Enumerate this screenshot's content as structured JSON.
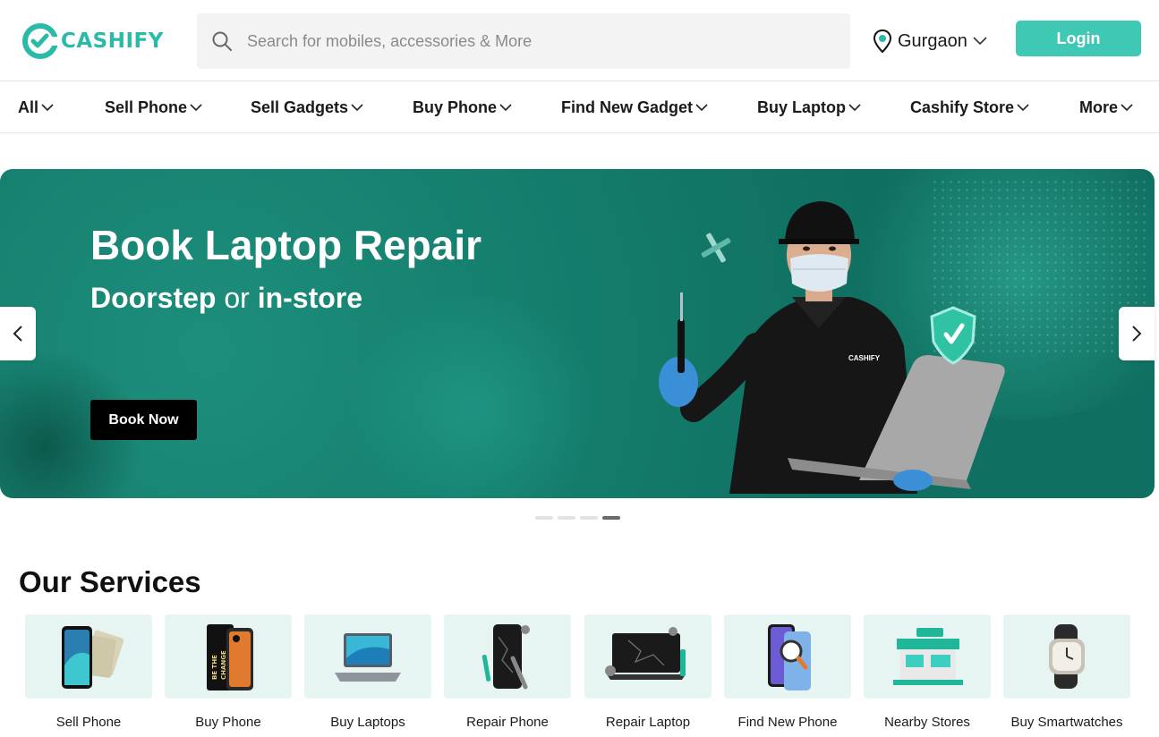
{
  "header": {
    "logo_text": "CASHIFY",
    "search_placeholder": "Search for mobiles, accessories & More",
    "location": "Gurgaon",
    "login_label": "Login",
    "brand_color": "#3fc9b5",
    "icons": {
      "search": "search-icon",
      "location": "location-pin-icon",
      "chevron": "chevron-down-icon"
    }
  },
  "nav": {
    "items": [
      {
        "label": "All"
      },
      {
        "label": "Sell Phone"
      },
      {
        "label": "Sell Gadgets"
      },
      {
        "label": "Buy Phone"
      },
      {
        "label": "Find New Gadget"
      },
      {
        "label": "Buy Laptop"
      },
      {
        "label": "Cashify Store"
      },
      {
        "label": "More"
      }
    ]
  },
  "banner": {
    "title": "Book Laptop Repair",
    "subtitle_part1": "Doorstep",
    "subtitle_or": " or ",
    "subtitle_part2": "in-store",
    "cta_label": "Book Now",
    "shirt_logo": "CASHIFY",
    "slide_count": 4,
    "active_slide": 4,
    "background_color": "#137a6a"
  },
  "services": {
    "title": "Our Services",
    "items": [
      {
        "label": "Sell Phone",
        "icon": "sell-phone-icon"
      },
      {
        "label": "Buy Phone",
        "icon": "buy-phone-icon"
      },
      {
        "label": "Buy Laptops",
        "icon": "laptop-icon"
      },
      {
        "label": "Repair Phone",
        "icon": "repair-phone-icon"
      },
      {
        "label": "Repair Laptop",
        "icon": "repair-laptop-icon"
      },
      {
        "label": "Find New Phone",
        "icon": "find-phone-icon"
      },
      {
        "label": "Nearby Stores",
        "icon": "store-icon"
      },
      {
        "label": "Buy Smartwatches",
        "icon": "smartwatch-icon"
      }
    ]
  }
}
